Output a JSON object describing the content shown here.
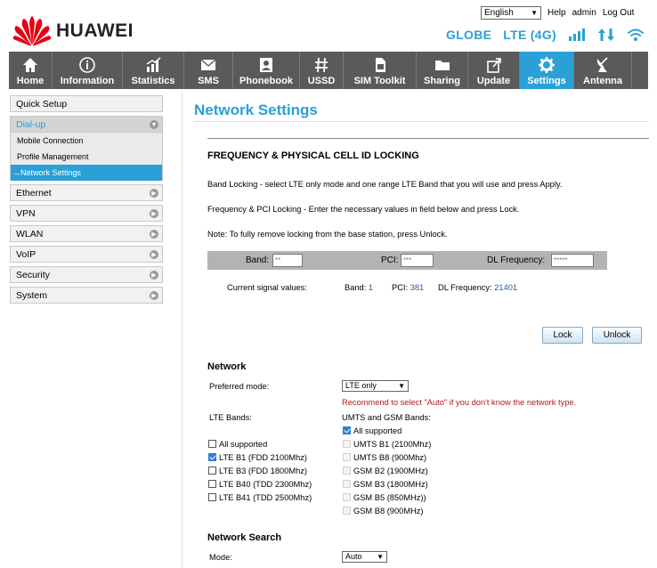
{
  "header": {
    "brand": "HUAWEI",
    "language": "English",
    "links": {
      "help": "Help",
      "user": "admin",
      "logout": "Log Out"
    },
    "status": {
      "operator": "GLOBE",
      "network": "LTE (4G)"
    }
  },
  "nav": {
    "items": [
      {
        "label": "Home",
        "icon": "home-icon"
      },
      {
        "label": "Information",
        "icon": "info-icon"
      },
      {
        "label": "Statistics",
        "icon": "chart-icon"
      },
      {
        "label": "SMS",
        "icon": "envelope-icon"
      },
      {
        "label": "Phonebook",
        "icon": "contact-icon"
      },
      {
        "label": "USSD",
        "icon": "hash-icon"
      },
      {
        "label": "SIM Toolkit",
        "icon": "sim-icon"
      },
      {
        "label": "Sharing",
        "icon": "folder-icon"
      },
      {
        "label": "Update",
        "icon": "update-icon"
      },
      {
        "label": "Settings",
        "icon": "gear-icon"
      },
      {
        "label": "Antenna",
        "icon": "antenna-icon"
      }
    ],
    "active": "Settings"
  },
  "sidebar": {
    "quick_setup": "Quick Setup",
    "dialup": "Dial-up",
    "dialup_items": [
      "Mobile Connection",
      "Profile Management",
      "Network Settings"
    ],
    "items": [
      "Ethernet",
      "VPN",
      "WLAN",
      "VoIP",
      "Security",
      "System"
    ]
  },
  "main": {
    "title": "Network Settings",
    "locking_title": "FREQUENCY & PHYSICAL CELL ID LOCKING",
    "para1": "Band Locking - select LTE only mode and one range LTE Band that you will use and press Apply.",
    "para2": "Frequency & PCI Locking - Enter the necessary values in field below and press Lock.",
    "para3": "Note: To fully remove locking from the base station, press Unlock.",
    "lock_fields": {
      "band_label": "Band:",
      "band_placeholder": "**",
      "pci_label": "PCI:",
      "pci_placeholder": "***",
      "dl_label": "DL Frequency:",
      "dl_placeholder": "*****"
    },
    "current": {
      "label": "Current signal values:",
      "band_label": "Band:",
      "band": "1",
      "pci_label": "PCI:",
      "pci": "381",
      "dl_label": "DL Frequency:",
      "dl": "21401"
    },
    "lock_button": "Lock",
    "unlock_button": "Unlock",
    "network_title": "Network",
    "preferred_label": "Preferred mode:",
    "preferred_value": "LTE only",
    "recommend": "Recommend to select \"Auto\" if you don't know the network type.",
    "lte_bands_label": "LTE Bands:",
    "umts_label": "UMTS and GSM Bands:",
    "lte_bands": [
      {
        "label": "All supported",
        "checked": false
      },
      {
        "label": "LTE B1 (FDD 2100Mhz)",
        "checked": true
      },
      {
        "label": "LTE B3 (FDD 1800Mhz)",
        "checked": false
      },
      {
        "label": "LTE B40 (TDD 2300Mhz)",
        "checked": false
      },
      {
        "label": "LTE B41 (TDD 2500Mhz)",
        "checked": false
      }
    ],
    "umts_bands": [
      {
        "label": "All supported",
        "checked": true
      },
      {
        "label": "UMTS B1 (2100Mhz)",
        "checked": false
      },
      {
        "label": "UMTS B8 (900Mhz)",
        "checked": false
      },
      {
        "label": "GSM B2 (1900MHz)",
        "checked": false
      },
      {
        "label": "GSM B3 (1800MHz)",
        "checked": false
      },
      {
        "label": "GSM B5 (850MHz))",
        "checked": false
      },
      {
        "label": "GSM B8 (900MHz)",
        "checked": false
      }
    ],
    "search_title": "Network Search",
    "mode_label": "Mode:",
    "mode_value": "Auto"
  },
  "colors": {
    "accent": "#2aa0d6",
    "nav_bg": "#5a5a5a",
    "warning": "#b01a1a",
    "logo": "#e60012"
  }
}
